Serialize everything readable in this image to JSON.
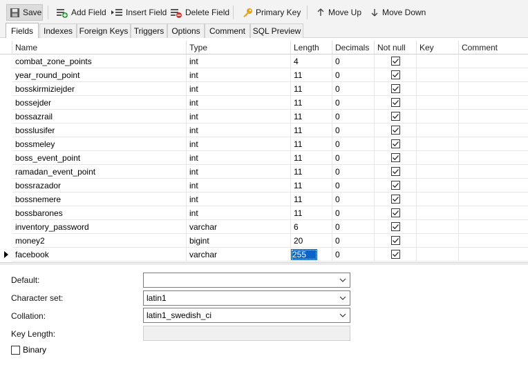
{
  "toolbar": {
    "save": "Save",
    "add_field": "Add Field",
    "insert_field": "Insert Field",
    "delete_field": "Delete Field",
    "primary_key": "Primary Key",
    "move_up": "Move Up",
    "move_down": "Move Down"
  },
  "tabs": [
    "Fields",
    "Indexes",
    "Foreign Keys",
    "Triggers",
    "Options",
    "Comment",
    "SQL Preview"
  ],
  "grid": {
    "headers": [
      "Name",
      "Type",
      "Length",
      "Decimals",
      "Not null",
      "Key",
      "Comment"
    ],
    "rows": [
      {
        "name": "combat_zone_points",
        "type": "int",
        "length": "4",
        "decimals": "0",
        "not_null": true
      },
      {
        "name": "year_round_point",
        "type": "int",
        "length": "11",
        "decimals": "0",
        "not_null": true
      },
      {
        "name": "bosskirmiziejder",
        "type": "int",
        "length": "11",
        "decimals": "0",
        "not_null": true
      },
      {
        "name": "bossejder",
        "type": "int",
        "length": "11",
        "decimals": "0",
        "not_null": true
      },
      {
        "name": "bossazrail",
        "type": "int",
        "length": "11",
        "decimals": "0",
        "not_null": true
      },
      {
        "name": "bosslusifer",
        "type": "int",
        "length": "11",
        "decimals": "0",
        "not_null": true
      },
      {
        "name": "bossmeley",
        "type": "int",
        "length": "11",
        "decimals": "0",
        "not_null": true
      },
      {
        "name": "boss_event_point",
        "type": "int",
        "length": "11",
        "decimals": "0",
        "not_null": true
      },
      {
        "name": "ramadan_event_point",
        "type": "int",
        "length": "11",
        "decimals": "0",
        "not_null": true
      },
      {
        "name": "bossrazador",
        "type": "int",
        "length": "11",
        "decimals": "0",
        "not_null": true
      },
      {
        "name": "bossnemere",
        "type": "int",
        "length": "11",
        "decimals": "0",
        "not_null": true
      },
      {
        "name": "bossbarones",
        "type": "int",
        "length": "11",
        "decimals": "0",
        "not_null": true
      },
      {
        "name": "inventory_password",
        "type": "varchar",
        "length": "6",
        "decimals": "0",
        "not_null": true
      },
      {
        "name": "money2",
        "type": "bigint",
        "length": "20",
        "decimals": "0",
        "not_null": true
      },
      {
        "name": "facebook",
        "type": "varchar",
        "length": "255",
        "decimals": "0",
        "not_null": true
      }
    ]
  },
  "properties": {
    "default_label": "Default:",
    "default_value": "",
    "charset_label": "Character set:",
    "charset_value": "latin1",
    "collation_label": "Collation:",
    "collation_value": "latin1_swedish_ci",
    "key_length_label": "Key Length:",
    "binary_label": "Binary"
  },
  "colors": {
    "selection": "#0a64c8",
    "toolbar_bg": "#f3f3f3"
  }
}
